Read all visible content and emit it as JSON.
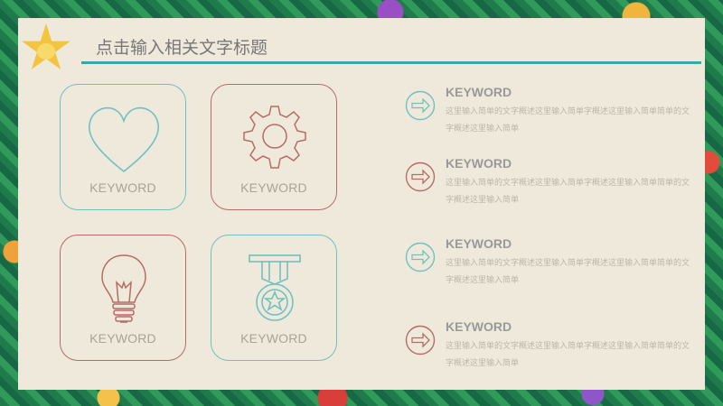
{
  "slide": {
    "title": "点击输入相关文字标题"
  },
  "cards": [
    {
      "label": "KEYWORD",
      "icon": "heart-icon",
      "color": "#6fc1c2"
    },
    {
      "label": "KEYWORD",
      "icon": "gear-icon",
      "color": "#b76b67"
    },
    {
      "label": "KEYWORD",
      "icon": "lightbulb-icon",
      "color": "#b76b67"
    },
    {
      "label": "KEYWORD",
      "icon": "medal-icon",
      "color": "#6fc1c2"
    }
  ],
  "items": [
    {
      "heading": "KEYWORD",
      "text": "这里输入简单的文字概述这里输入简单字概述这里输入简单简单的文字概述这里输入简单",
      "icon": "arrow-right-icon",
      "color": "#6fc1c2"
    },
    {
      "heading": "KEYWORD",
      "text": "这里输入简单的文字概述这里输入简单字概述这里输入简单简单的文字概述这里输入简单",
      "icon": "arrow-right-icon",
      "color": "#b76b67"
    },
    {
      "heading": "KEYWORD",
      "text": "这里输入简单的文字概述这里输入简单字概述这里输入简单简单的文字概述这里输入简单",
      "icon": "arrow-right-icon",
      "color": "#6fc1c2"
    },
    {
      "heading": "KEYWORD",
      "text": "这里输入简单的文字概述这里输入简单字概述这里输入简单简单的文字概述这里输入简单",
      "icon": "arrow-right-icon",
      "color": "#b76b67"
    }
  ],
  "colors": {
    "teal": "#39a6a8",
    "card_teal": "#6fc1c2",
    "card_red": "#b76b67",
    "star": "#f3c43f",
    "background": "#efe9dc"
  }
}
